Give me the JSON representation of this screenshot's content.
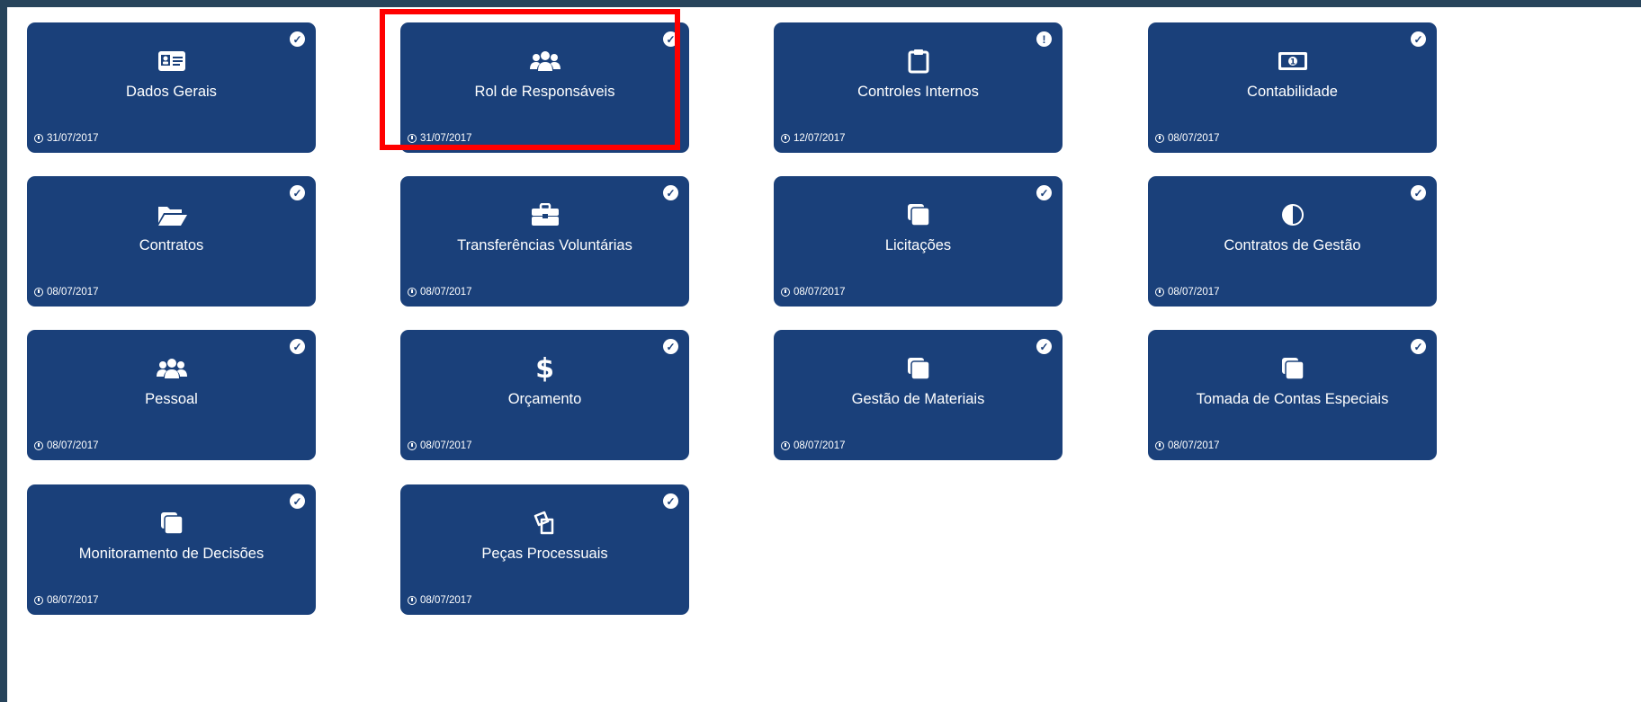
{
  "tiles": [
    {
      "title": "Dados Gerais",
      "date": "31/07/2017",
      "icon": "id-card-icon",
      "status": "check"
    },
    {
      "title": "Rol de Responsáveis",
      "date": "31/07/2017",
      "icon": "users-icon",
      "status": "check"
    },
    {
      "title": "Controles Internos",
      "date": "12/07/2017",
      "icon": "clipboard-icon",
      "status": "alert"
    },
    {
      "title": "Contabilidade",
      "date": "08/07/2017",
      "icon": "money-icon",
      "status": "check"
    },
    {
      "title": "Contratos",
      "date": "08/07/2017",
      "icon": "folder-open-icon",
      "status": "check"
    },
    {
      "title": "Transferências Voluntárias",
      "date": "08/07/2017",
      "icon": "briefcase-icon",
      "status": "check"
    },
    {
      "title": "Licitações",
      "date": "08/07/2017",
      "icon": "copy-icon",
      "status": "check"
    },
    {
      "title": "Contratos de Gestão",
      "date": "08/07/2017",
      "icon": "pie-chart-icon",
      "status": "check"
    },
    {
      "title": "Pessoal",
      "date": "08/07/2017",
      "icon": "users-icon",
      "status": "check"
    },
    {
      "title": "Orçamento",
      "date": "08/07/2017",
      "icon": "dollar-icon",
      "dollar": "$",
      "status": "check"
    },
    {
      "title": "Gestão de Materiais",
      "date": "08/07/2017",
      "icon": "copy-icon",
      "status": "check"
    },
    {
      "title": "Tomada de Contas Especiais",
      "date": "08/07/2017",
      "icon": "copy-icon",
      "status": "check"
    },
    {
      "title": "Monitoramento de Decisões",
      "date": "08/07/2017",
      "icon": "copy-icon",
      "status": "check"
    },
    {
      "title": "Peças Processuais",
      "date": "08/07/2017",
      "icon": "files-icon",
      "status": "check"
    }
  ],
  "status_symbols": {
    "check": "✓",
    "alert": "!"
  },
  "colors": {
    "tile": "#1a407a",
    "highlight": "#ff0000",
    "border": "#27445b"
  }
}
